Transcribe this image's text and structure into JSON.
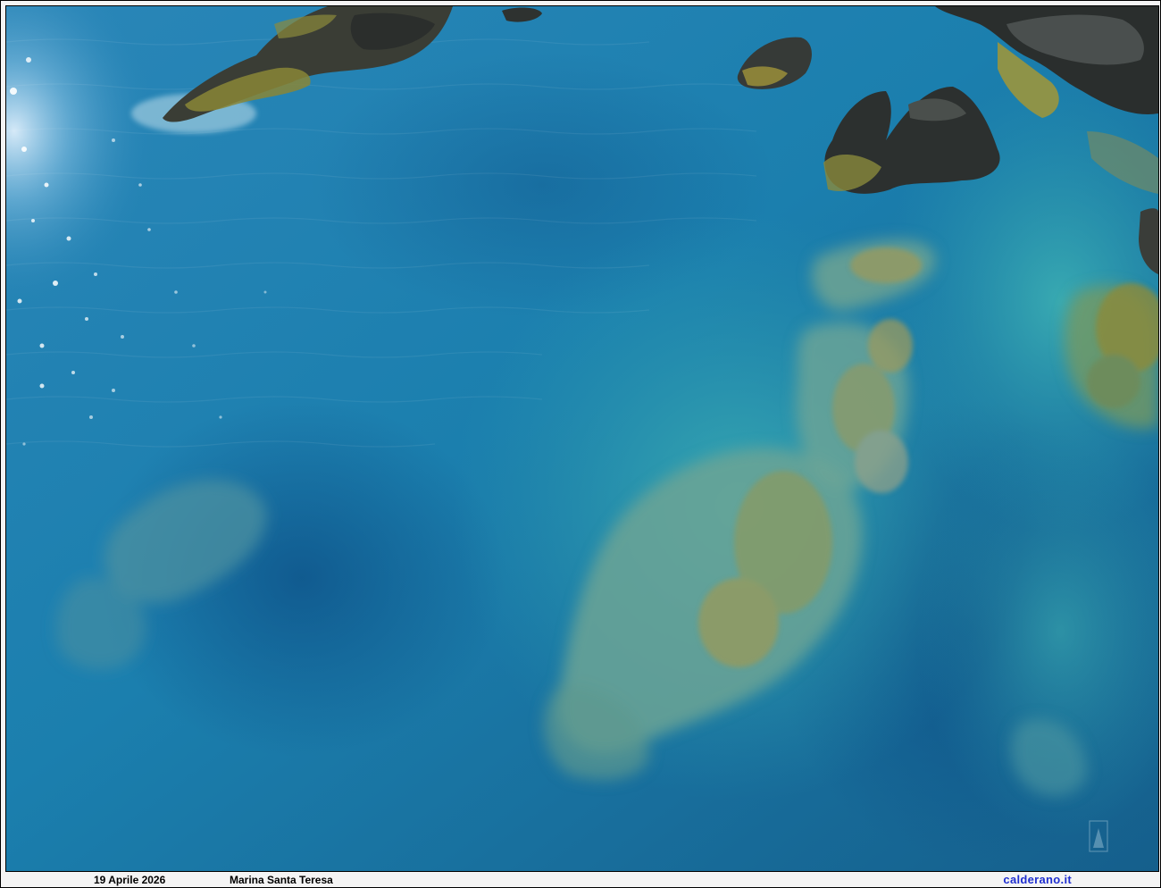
{
  "photo": {
    "subject": "aerial-sea-with-submerged-rocks"
  },
  "caption": {
    "date": "19 Aprile 2026",
    "place": "Marina Santa Teresa",
    "site": "calderano.it"
  },
  "colors": {
    "deep_water": "#0f5f95",
    "mid_water": "#1b80ae",
    "shallow_water": "#2c9fb0",
    "rock_dark": "#2e3433",
    "algae": "#8e8a3a",
    "site_link": "#1f2fd0"
  }
}
